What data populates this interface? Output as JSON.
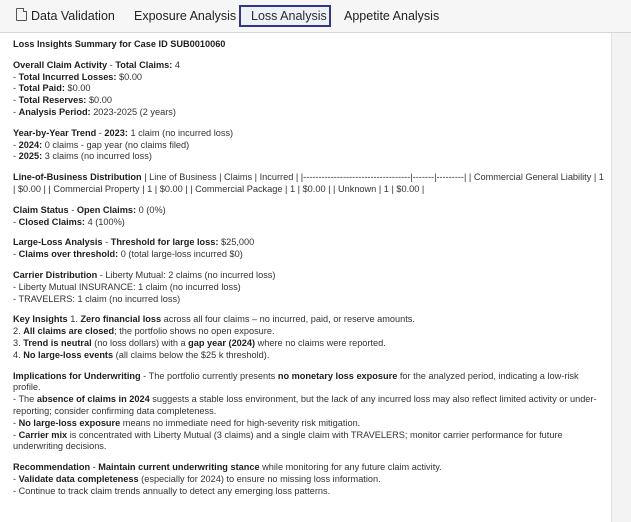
{
  "tabs": [
    {
      "label": "Data Validation",
      "icon": "document-icon"
    },
    {
      "label": "Exposure Analysis"
    },
    {
      "label": "Loss Analysis",
      "active": true
    },
    {
      "label": "Appetite Analysis"
    }
  ],
  "report": {
    "title": "Loss Insights Summary for Case ID SUB0010060",
    "claim_activity": {
      "heading": "Overall Claim Activity",
      "l1_key": "Total Claims:",
      "l1_val": "4",
      "l2_key": "Total Incurred Losses:",
      "l2_val": "$0.00",
      "l3_key": "Total Paid:",
      "l3_val": "$0.00",
      "l4_key": "Total Reserves:",
      "l4_val": "$0.00",
      "l5_key": "Analysis Period:",
      "l5_val": "2023-2025 (2 years)"
    },
    "yoy": {
      "heading": "Year-by-Year Trend",
      "l1_key": "2023:",
      "l1_val": "1 claim (no incurred loss)",
      "l2_key": "2024:",
      "l2_val": "0 claims - gap year (no claims filed)",
      "l3_key": "2025:",
      "l3_val": "3 claims (no incurred loss)"
    },
    "lob": {
      "heading": "Line-of-Business Distribution",
      "text": "| Line of Business | Claims | Incurred | |-----------------------------------|-------|---------| | Commercial General Liability | 1 | $0.00 | | Commercial Property | 1 | $0.00 | | Commercial Package | 1 | $0.00 | | Unknown | 1 | $0.00 |"
    },
    "status": {
      "heading": "Claim Status",
      "l1_key": "Open Claims:",
      "l1_val": "0 (0%)",
      "l2_key": "Closed Claims:",
      "l2_val": "4 (100%)"
    },
    "large_loss": {
      "heading": "Large-Loss Analysis",
      "l1_key": "Threshold for large loss:",
      "l1_val": "$25,000",
      "l2_key": "Claims over threshold:",
      "l2_val": "0 (total large-loss incurred $0)"
    },
    "carrier": {
      "heading": "Carrier Distribution",
      "l1": "Liberty Mutual: 2 claims (no incurred loss)",
      "l2": "Liberty Mutual INSURANCE: 1 claim (no incurred loss)",
      "l3": "TRAVELERS: 1 claim (no incurred loss)"
    },
    "insights": {
      "heading": "Key Insights",
      "i1_num": "1.",
      "i1_b": "Zero financial loss",
      "i1_t": " across all four claims – no incurred, paid, or reserve amounts.",
      "i2_num": "2.",
      "i2_b": "All claims are closed",
      "i2_t": "; the portfolio shows no open exposure.",
      "i3_num": "3.",
      "i3_b": "Trend is neutral",
      "i3_t1": " (no loss dollars) with a ",
      "i3_b2": "gap year (2024)",
      "i3_t2": " where no claims were reported.",
      "i4_num": "4.",
      "i4_b": "No large-loss events",
      "i4_t": " (all claims below the $25 k threshold)."
    },
    "underwriting": {
      "heading": "Implications for Underwriting",
      "p1_t1": " - The portfolio currently presents ",
      "p1_b": "no monetary loss exposure",
      "p1_t2": " for the analyzed period, indicating a low-risk profile.",
      "p2_t1": "- The ",
      "p2_b": "absence of claims in 2024",
      "p2_t2": " suggests a stable loss environment, but the lack of any incurred loss may also reflect limited activity or under-reporting; consider confirming data completeness.",
      "p3_b": "No large-loss exposure",
      "p3_t": " means no immediate need for high-severity risk mitigation.",
      "p4_b": "Carrier mix",
      "p4_t": " is concentrated with Liberty Mutual (3 claims) and a single claim with TRAVELERS; monitor carrier performance for future underwriting decisions."
    },
    "recommendation": {
      "heading": "Recommendation",
      "r1_b": "Maintain current underwriting stance",
      "r1_t": " while monitoring for any future claim activity.",
      "r2_b": "Validate data completeness",
      "r2_t": " (especially for 2024) to ensure no missing loss information.",
      "r3_t": "- Continue to track claim trends annually to detect any emerging loss patterns."
    }
  }
}
